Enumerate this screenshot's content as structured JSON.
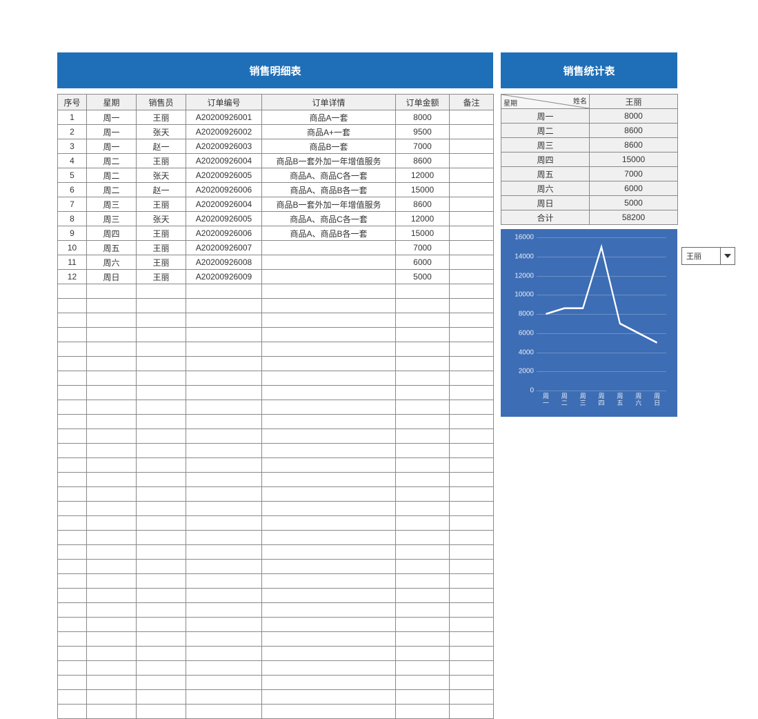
{
  "titles": {
    "detail": "销售明细表",
    "summary": "销售统计表"
  },
  "detail": {
    "headers": [
      "序号",
      "星期",
      "销售员",
      "订单编号",
      "订单详情",
      "订单金额",
      "备注"
    ],
    "rows": [
      {
        "no": "1",
        "day": "周一",
        "sales": "王丽",
        "order": "A20200926001",
        "desc": "商品A一套",
        "amount": "8000",
        "note": ""
      },
      {
        "no": "2",
        "day": "周一",
        "sales": "张天",
        "order": "A20200926002",
        "desc": "商品A+一套",
        "amount": "9500",
        "note": ""
      },
      {
        "no": "3",
        "day": "周一",
        "sales": "赵一",
        "order": "A20200926003",
        "desc": "商品B一套",
        "amount": "7000",
        "note": ""
      },
      {
        "no": "4",
        "day": "周二",
        "sales": "王丽",
        "order": "A20200926004",
        "desc": "商品B一套外加一年增值服务",
        "amount": "8600",
        "note": ""
      },
      {
        "no": "5",
        "day": "周二",
        "sales": "张天",
        "order": "A20200926005",
        "desc": "商品A、商品C各一套",
        "amount": "12000",
        "note": ""
      },
      {
        "no": "6",
        "day": "周二",
        "sales": "赵一",
        "order": "A20200926006",
        "desc": "商品A、商品B各一套",
        "amount": "15000",
        "note": ""
      },
      {
        "no": "7",
        "day": "周三",
        "sales": "王丽",
        "order": "A20200926004",
        "desc": "商品B一套外加一年增值服务",
        "amount": "8600",
        "note": ""
      },
      {
        "no": "8",
        "day": "周三",
        "sales": "张天",
        "order": "A20200926005",
        "desc": "商品A、商品C各一套",
        "amount": "12000",
        "note": ""
      },
      {
        "no": "9",
        "day": "周四",
        "sales": "王丽",
        "order": "A20200926006",
        "desc": "商品A、商品B各一套",
        "amount": "15000",
        "note": ""
      },
      {
        "no": "10",
        "day": "周五",
        "sales": "王丽",
        "order": "A20200926007",
        "desc": "",
        "amount": "7000",
        "note": ""
      },
      {
        "no": "11",
        "day": "周六",
        "sales": "王丽",
        "order": "A20200926008",
        "desc": "",
        "amount": "6000",
        "note": ""
      },
      {
        "no": "12",
        "day": "周日",
        "sales": "王丽",
        "order": "A20200926009",
        "desc": "",
        "amount": "5000",
        "note": ""
      }
    ],
    "empty_rows": 30
  },
  "summary": {
    "corner": {
      "row": "星期",
      "col": "姓名"
    },
    "person": "王丽",
    "rows": [
      {
        "day": "周一",
        "val": "8000"
      },
      {
        "day": "周二",
        "val": "8600"
      },
      {
        "day": "周三",
        "val": "8600"
      },
      {
        "day": "周四",
        "val": "15000"
      },
      {
        "day": "周五",
        "val": "7000"
      },
      {
        "day": "周六",
        "val": "6000"
      },
      {
        "day": "周日",
        "val": "5000"
      }
    ],
    "total_label": "合计",
    "total_value": "58200"
  },
  "filter": {
    "selected": "王丽"
  },
  "chart_data": {
    "type": "line",
    "categories": [
      "周一",
      "周二",
      "周三",
      "周四",
      "周五",
      "周六",
      "周日"
    ],
    "values": [
      8000,
      8600,
      8600,
      15000,
      7000,
      6000,
      5000
    ],
    "ymin": 0,
    "ymax": 16000,
    "yticks": [
      0,
      2000,
      4000,
      6000,
      8000,
      10000,
      12000,
      14000,
      16000
    ]
  }
}
